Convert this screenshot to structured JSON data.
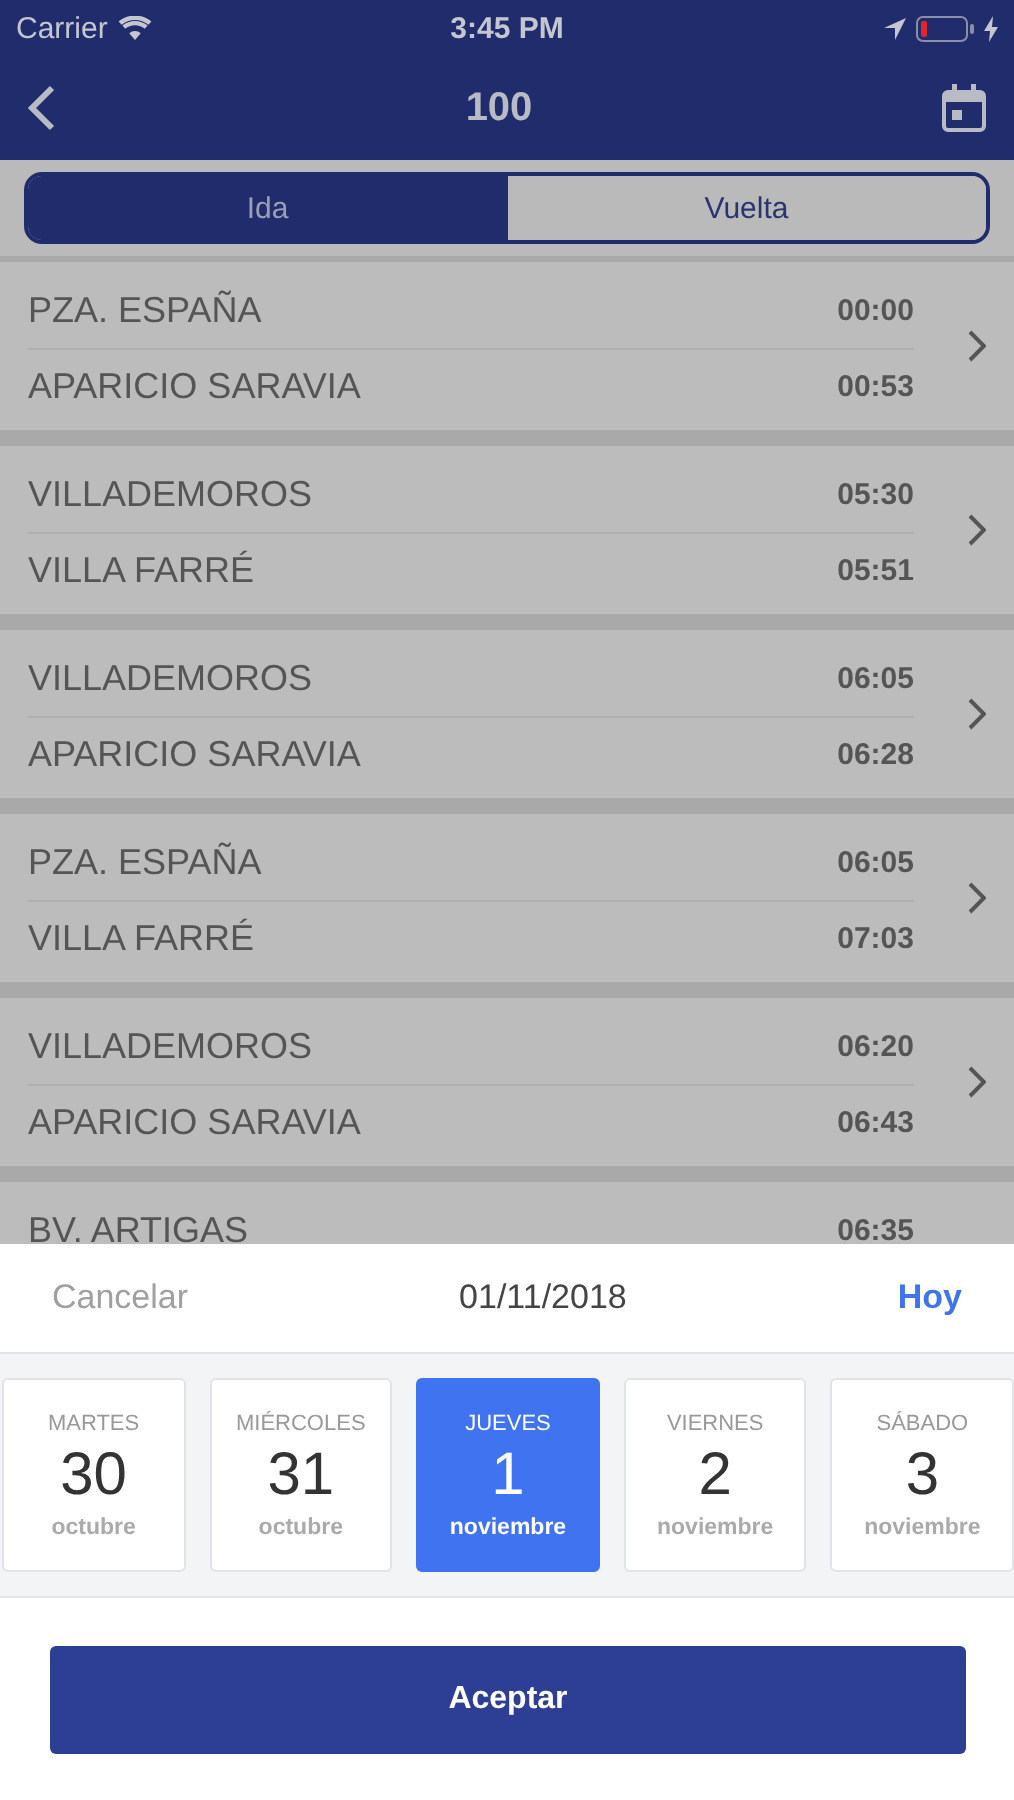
{
  "status_bar": {
    "carrier": "Carrier",
    "time": "3:45 PM"
  },
  "nav": {
    "title": "100"
  },
  "segments": [
    {
      "label": "Ida",
      "selected": true
    },
    {
      "label": "Vuelta",
      "selected": false
    }
  ],
  "trips": [
    {
      "stops": [
        {
          "name": "PZA. ESPAÑA",
          "time": "00:00"
        },
        {
          "name": "APARICIO SARAVIA",
          "time": "00:53"
        }
      ]
    },
    {
      "stops": [
        {
          "name": "VILLADEMOROS",
          "time": "05:30"
        },
        {
          "name": "VILLA FARRÉ",
          "time": "05:51"
        }
      ]
    },
    {
      "stops": [
        {
          "name": "VILLADEMOROS",
          "time": "06:05"
        },
        {
          "name": "APARICIO SARAVIA",
          "time": "06:28"
        }
      ]
    },
    {
      "stops": [
        {
          "name": "PZA. ESPAÑA",
          "time": "06:05"
        },
        {
          "name": "VILLA FARRÉ",
          "time": "07:03"
        }
      ]
    },
    {
      "stops": [
        {
          "name": "VILLADEMOROS",
          "time": "06:20"
        },
        {
          "name": "APARICIO SARAVIA",
          "time": "06:43"
        }
      ]
    },
    {
      "stops": [
        {
          "name": "BV. ARTIGAS",
          "time": "06:35"
        }
      ]
    }
  ],
  "date_picker": {
    "cancel": "Cancelar",
    "date": "01/11/2018",
    "today": "Hoy",
    "days": [
      {
        "weekday": "MARTES",
        "day": "30",
        "month": "octubre",
        "selected": false
      },
      {
        "weekday": "MIÉRCOLES",
        "day": "31",
        "month": "octubre",
        "selected": false
      },
      {
        "weekday": "JUEVES",
        "day": "1",
        "month": "noviembre",
        "selected": true
      },
      {
        "weekday": "VIERNES",
        "day": "2",
        "month": "noviembre",
        "selected": false
      },
      {
        "weekday": "SÁBADO",
        "day": "3",
        "month": "noviembre",
        "selected": false
      }
    ],
    "accept": "Aceptar"
  }
}
